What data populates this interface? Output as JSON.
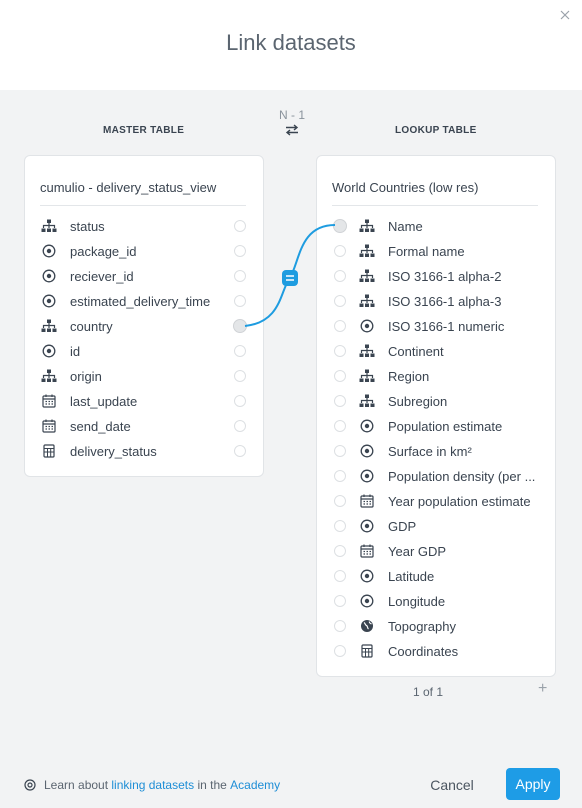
{
  "dialog": {
    "title": "Link datasets",
    "relation_type": "N - 1",
    "master_label": "MASTER TABLE",
    "lookup_label": "LOOKUP TABLE"
  },
  "master": {
    "title": "cumulio - delivery_status_view",
    "columns": [
      {
        "label": "status",
        "icon": "hierarchy-icon"
      },
      {
        "label": "package_id",
        "icon": "numeric-icon"
      },
      {
        "label": "reciever_id",
        "icon": "numeric-icon"
      },
      {
        "label": "estimated_delivery_time",
        "icon": "numeric-icon"
      },
      {
        "label": "country",
        "icon": "hierarchy-icon"
      },
      {
        "label": "id",
        "icon": "numeric-icon"
      },
      {
        "label": "origin",
        "icon": "hierarchy-icon"
      },
      {
        "label": "last_update",
        "icon": "calendar-icon"
      },
      {
        "label": "send_date",
        "icon": "calendar-icon"
      },
      {
        "label": "delivery_status",
        "icon": "calculator-icon"
      }
    ],
    "linked_column": "country"
  },
  "lookup": {
    "title": "World Countries (low res)",
    "columns": [
      {
        "label": "Name",
        "icon": "hierarchy-icon"
      },
      {
        "label": "Formal name",
        "icon": "hierarchy-icon"
      },
      {
        "label": "ISO 3166-1 alpha-2",
        "icon": "hierarchy-icon"
      },
      {
        "label": "ISO 3166-1 alpha-3",
        "icon": "hierarchy-icon"
      },
      {
        "label": "ISO 3166-1 numeric",
        "icon": "numeric-icon"
      },
      {
        "label": "Continent",
        "icon": "hierarchy-icon"
      },
      {
        "label": "Region",
        "icon": "hierarchy-icon"
      },
      {
        "label": "Subregion",
        "icon": "hierarchy-icon"
      },
      {
        "label": "Population estimate",
        "icon": "numeric-icon"
      },
      {
        "label": "Surface in km²",
        "icon": "numeric-icon"
      },
      {
        "label": "Population density (per ...",
        "icon": "numeric-icon"
      },
      {
        "label": "Year population estimate",
        "icon": "calendar-icon"
      },
      {
        "label": "GDP",
        "icon": "numeric-icon"
      },
      {
        "label": "Year GDP",
        "icon": "calendar-icon"
      },
      {
        "label": "Latitude",
        "icon": "numeric-icon"
      },
      {
        "label": "Longitude",
        "icon": "numeric-icon"
      },
      {
        "label": "Topography",
        "icon": "globe-icon"
      },
      {
        "label": "Coordinates",
        "icon": "calculator-icon"
      }
    ],
    "linked_column": "Name",
    "pager": "1 of 1"
  },
  "footer": {
    "note_prefix": "Learn about ",
    "note_link": "linking datasets",
    "note_middle": " in the ",
    "note_link2": "Academy",
    "cancel_label": "Cancel",
    "apply_label": "Apply"
  },
  "colors": {
    "accent": "#1e9ce6",
    "link_line": "#1e9ce0"
  }
}
